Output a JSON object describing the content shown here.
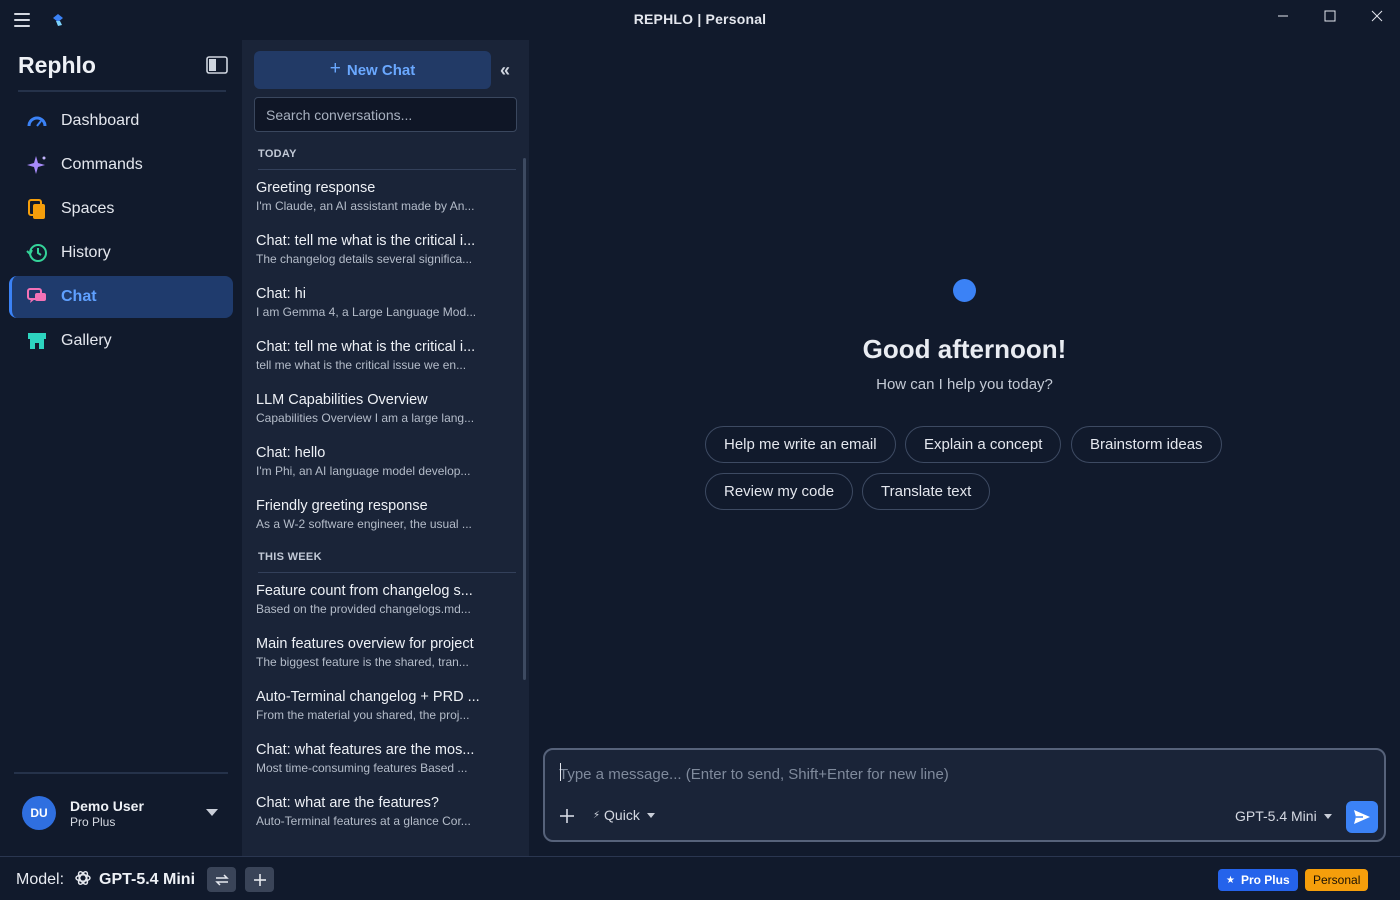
{
  "window": {
    "title": "REPHLO | Personal"
  },
  "sidebar": {
    "brand": "Rephlo",
    "items": [
      {
        "label": "Dashboard",
        "icon": "gauge-icon",
        "color": "#3b82f6"
      },
      {
        "label": "Commands",
        "icon": "sparkle-icon",
        "color": "#a78bfa"
      },
      {
        "label": "Spaces",
        "icon": "files-icon",
        "color": "#f59e0b"
      },
      {
        "label": "History",
        "icon": "history-icon",
        "color": "#34d399"
      },
      {
        "label": "Chat",
        "icon": "chat-bubbles-icon",
        "color": "#f472b6",
        "active": true
      },
      {
        "label": "Gallery",
        "icon": "store-icon",
        "color": "#2dd4bf"
      }
    ],
    "user": {
      "initials": "DU",
      "name": "Demo User",
      "plan": "Pro Plus"
    }
  },
  "conversations": {
    "new_chat_label": "New Chat",
    "search_placeholder": "Search conversations...",
    "groups": [
      {
        "header": "TODAY",
        "items": [
          {
            "title": "Greeting response",
            "preview": "I'm Claude, an AI assistant made by An..."
          },
          {
            "title": "Chat: tell me what is the critical i...",
            "preview": "The changelog details several significa..."
          },
          {
            "title": "Chat: hi",
            "preview": "I am Gemma 4, a Large Language Mod..."
          },
          {
            "title": "Chat: tell me what is the critical i...",
            "preview": "tell me what is the critical issue we en..."
          },
          {
            "title": "LLM Capabilities Overview",
            "preview": "Capabilities Overview I am a large lang..."
          },
          {
            "title": "Chat: hello",
            "preview": "I'm Phi, an AI language model develop..."
          },
          {
            "title": "Friendly greeting response",
            "preview": "As a W-2 software engineer, the usual ..."
          }
        ]
      },
      {
        "header": "THIS WEEK",
        "items": [
          {
            "title": "Feature count from changelog s...",
            "preview": "Based on the provided changelogs.md..."
          },
          {
            "title": "Main features overview for project",
            "preview": "The biggest feature is the shared, tran..."
          },
          {
            "title": "Auto-Terminal changelog + PRD ...",
            "preview": "From the material you shared, the proj..."
          },
          {
            "title": "Chat: what features are the mos...",
            "preview": "Most time-consuming features Based ..."
          },
          {
            "title": "Chat: what are the features?",
            "preview": "Auto-Terminal features at a glance Cor..."
          }
        ]
      }
    ]
  },
  "main": {
    "greeting": "Good afternoon!",
    "subtitle": "How can I help you today?",
    "suggestions": [
      "Help me write an email",
      "Explain a concept",
      "Brainstorm ideas",
      "Review my code",
      "Translate text"
    ],
    "composer": {
      "placeholder": "Type a message... (Enter to send, Shift+Enter for new line)",
      "mode": "Quick",
      "model": "GPT-5.4 Mini"
    }
  },
  "statusbar": {
    "model_label": "Model:",
    "model_name": "GPT-5.4 Mini",
    "plan_badge": "Pro Plus",
    "workspace_badge": "Personal"
  },
  "colors": {
    "accent": "#3b82f6",
    "background": "#111a2c",
    "panel": "#1a2438",
    "badge_personal": "#f59e0b"
  }
}
